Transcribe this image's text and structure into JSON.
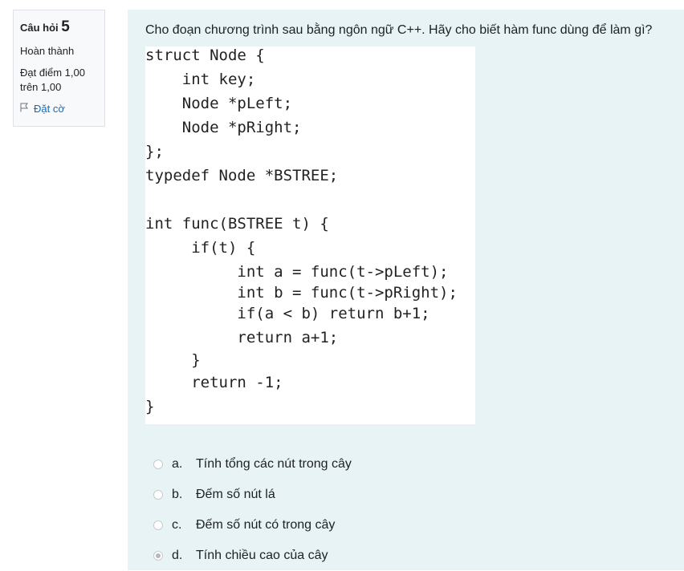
{
  "info": {
    "question_label": "Câu hỏi",
    "question_number": "5",
    "state": "Hoàn thành",
    "grade_line1": "Đạt điểm 1,00",
    "grade_line2": "trên 1,00",
    "flag_label": "Đặt cờ",
    "flag_icon": "flag-icon"
  },
  "question": {
    "text": "Cho đoạn chương trình sau bằng ngôn ngữ C++. Hãy cho biết hàm func dùng để làm gì?",
    "code_lines": [
      "struct Node {",
      "    int key;",
      "    Node *pLeft;",
      "    Node *pRight;",
      "};",
      "typedef Node *BSTREE;",
      "",
      "int func(BSTREE t) {",
      "     if(t) {",
      "          int a = func(t->pLeft);",
      "          int b = func(t->pRight);",
      "          if(a < b) return b+1;",
      "          return a+1;",
      "     }",
      "     return -1;",
      "}"
    ]
  },
  "answers": [
    {
      "letter": "a.",
      "text": "Tính tổng các nút trong cây",
      "checked": false
    },
    {
      "letter": "b.",
      "text": "Đếm số nút lá",
      "checked": false
    },
    {
      "letter": "c.",
      "text": "Đếm số nút có trong cây",
      "checked": false
    },
    {
      "letter": "d.",
      "text": "Tính chiều cao của cây",
      "checked": true
    }
  ],
  "colors": {
    "content_bg": "#e7f3f5",
    "link": "#0f6cbf"
  }
}
